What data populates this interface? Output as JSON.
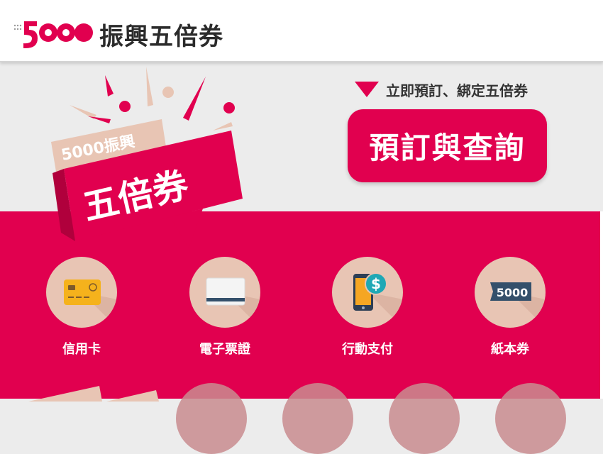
{
  "header": {
    "logo_text": "5000",
    "title": "振興五倍券"
  },
  "hero": {
    "badge": {
      "line1": "5000振興",
      "line2": "五倍券"
    },
    "cta_hint": "立即預訂、綁定五倍券",
    "cta_button": "預訂與查詢"
  },
  "methods": [
    {
      "label": "信用卡",
      "icon": "credit-card-icon"
    },
    {
      "label": "電子票證",
      "icon": "e-ticket-card-icon"
    },
    {
      "label": "行動支付",
      "icon": "mobile-payment-icon"
    },
    {
      "label": "紙本券",
      "icon": "paper-voucher-icon"
    }
  ],
  "paper_voucher_value": "5000",
  "colors": {
    "brand": "#e1004f",
    "circle": "#e8c5b4",
    "hero_bg": "#ececec"
  }
}
